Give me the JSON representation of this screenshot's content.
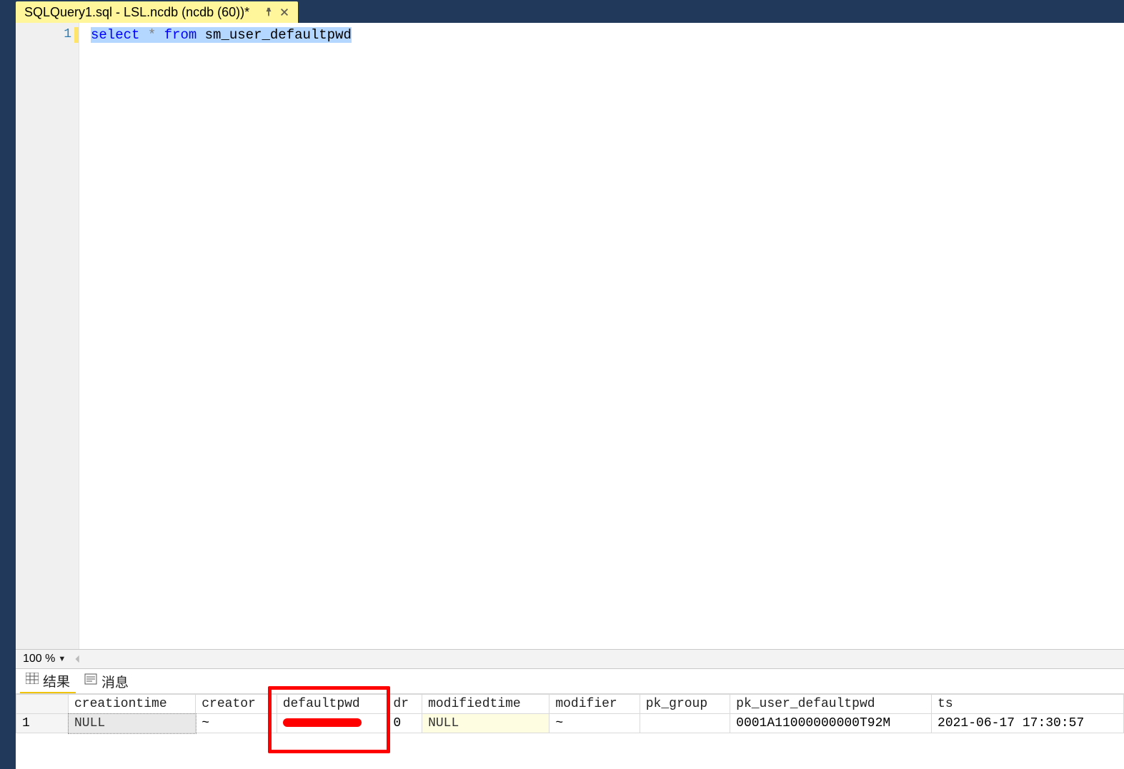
{
  "tab": {
    "title": "SQLQuery1.sql - LSL.ncdb (ncdb (60))*"
  },
  "editor": {
    "line_number": "1",
    "sql": {
      "kw_select": "select",
      "op_star": "*",
      "kw_from": "from",
      "ident_table": "sm_user_defaultpwd"
    }
  },
  "zoom": {
    "value": "100 %"
  },
  "result_tabs": {
    "results_label": "结果",
    "messages_label": "消息"
  },
  "grid": {
    "columns": [
      "creationtime",
      "creator",
      "defaultpwd",
      "dr",
      "modifiedtime",
      "modifier",
      "pk_group",
      "pk_user_defaultpwd",
      "ts"
    ],
    "rows": [
      {
        "rownum": "1",
        "creationtime": "NULL",
        "creator": "~",
        "defaultpwd": "[REDACTED]",
        "dr": "0",
        "modifiedtime": "NULL",
        "modifier": "~",
        "pk_group": "",
        "pk_user_defaultpwd": "0001A11000000000T92M",
        "ts": "2021-06-17 17:30:57"
      }
    ]
  }
}
